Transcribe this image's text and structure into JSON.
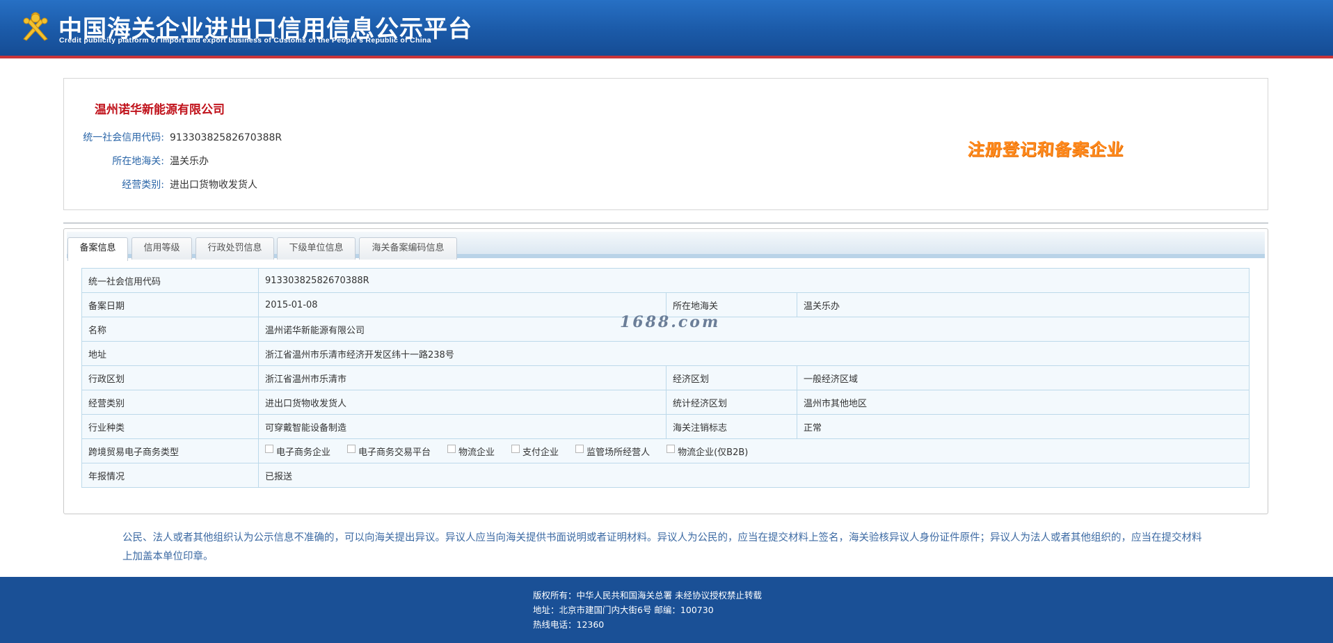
{
  "header": {
    "title_cn": "中国海关企业进出口信用信息公示平台",
    "title_en": "Credit publicity platform of import and export business of Customs of the People's Republic of China",
    "logo_icon": "customs-emblem-icon",
    "colors": {
      "bar": "#1b5aa8",
      "accent_line": "#c8353a"
    }
  },
  "company": {
    "name": "温州诺华新能源有限公司",
    "fields": [
      {
        "label": "统一社会信用代码:",
        "value": "91330382582670388R"
      },
      {
        "label": "所在地海关:",
        "value": "温关乐办"
      },
      {
        "label": "经营类别:",
        "value": "进出口货物收发货人"
      }
    ],
    "status_stamp": "注册登记和备案企业",
    "colors": {
      "name": "#c0121b",
      "label": "#2b66a8",
      "stamp": "#ff8a1e"
    }
  },
  "tabs": [
    {
      "label": "备案信息",
      "active": true
    },
    {
      "label": "信用等级",
      "active": false
    },
    {
      "label": "行政处罚信息",
      "active": false
    },
    {
      "label": "下级单位信息",
      "active": false
    },
    {
      "label": "海关备案编码信息",
      "active": false
    }
  ],
  "record": {
    "rows": [
      {
        "label": "统一社会信用代码",
        "value": "91330382582670388R"
      },
      {
        "label": "备案日期",
        "value": "2015-01-08",
        "label2": "所在地海关",
        "value2": "温关乐办"
      },
      {
        "label": "名称",
        "value": "温州诺华新能源有限公司"
      },
      {
        "label": "地址",
        "value": "浙江省温州市乐清市经济开发区纬十一路238号"
      },
      {
        "label": "行政区划",
        "value": "浙江省温州市乐清市",
        "label2": "经济区划",
        "value2": "一般经济区域"
      },
      {
        "label": "经营类别",
        "value": "进出口货物收发货人",
        "label2": "统计经济区划",
        "value2": "温州市其他地区"
      },
      {
        "label": "行业种类",
        "value": "可穿戴智能设备制造",
        "label2": "海关注销标志",
        "value2": "正常"
      },
      {
        "label": "跨境贸易电子商务类型"
      },
      {
        "label": "年报情况",
        "value": "已报送"
      }
    ],
    "ecommerce_types": [
      {
        "label": "电子商务企业",
        "checked": false
      },
      {
        "label": "电子商务交易平台",
        "checked": false
      },
      {
        "label": "物流企业",
        "checked": false
      },
      {
        "label": "支付企业",
        "checked": false
      },
      {
        "label": "监管场所经营人",
        "checked": false
      },
      {
        "label": "物流企业(仅B2B)",
        "checked": false
      }
    ]
  },
  "watermark": "1688.com",
  "notice": "公民、法人或者其他组织认为公示信息不准确的，可以向海关提出异议。异议人应当向海关提供书面说明或者证明材料。异议人为公民的，应当在提交材料上签名，海关验核异议人身份证件原件；异议人为法人或者其他组织的，应当在提交材料上加盖本单位印章。",
  "footer": {
    "copyright": "版权所有：中华人民共和国海关总署   未经协议授权禁止转载",
    "address": "地址：北京市建国门内大街6号 邮编：100730",
    "hotline": "热线电话：12360",
    "color": "#1a5096"
  }
}
